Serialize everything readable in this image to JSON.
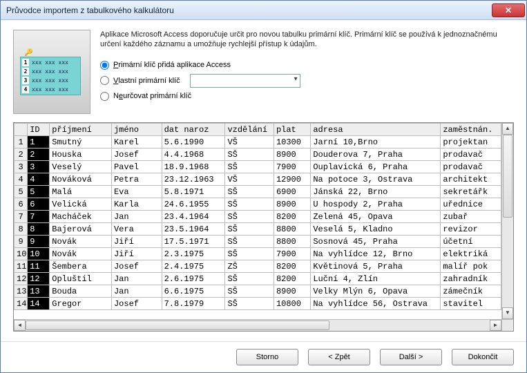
{
  "title": "Průvodce importem z tabulkového kalkulátoru",
  "description": "Aplikace Microsoft Access doporučuje určit pro novou tabulku primární klíč. Primární klíč se používá k jednoznačnému určení každého záznamu a umožňuje rychlejší přístup k údajům.",
  "radios": {
    "r1": "Primární klíč přidá aplikace Access",
    "r2": "Vlastní primární klíč",
    "r3": "Neurčovat primární klíč"
  },
  "headers": {
    "id": "ID",
    "prijmeni": "příjmení",
    "jmeno": "jméno",
    "datnaroz": "dat naroz",
    "vzdelani": "vzdělání",
    "plat": "plat",
    "adresa": "adresa",
    "zam": "zaměstnán."
  },
  "rows": [
    {
      "n": "1",
      "id": "1",
      "pr": "Smutný",
      "jm": "Karel",
      "dn": "5.6.1990",
      "vz": "VŠ",
      "pl": "10300",
      "ad": "Jarní 10,Brno",
      "za": "projektan"
    },
    {
      "n": "2",
      "id": "2",
      "pr": "Houska",
      "jm": "Josef",
      "dn": "4.4.1968",
      "vz": "SŠ",
      "pl": "8900",
      "ad": "Douderova 7, Praha",
      "za": "prodavač"
    },
    {
      "n": "3",
      "id": "3",
      "pr": "Veselý",
      "jm": "Pavel",
      "dn": "18.9.1968",
      "vz": "SŠ",
      "pl": "7900",
      "ad": "Ouplavická 6, Praha",
      "za": "prodavač"
    },
    {
      "n": "4",
      "id": "4",
      "pr": "Nováková",
      "jm": "Petra",
      "dn": "23.12.1963",
      "vz": "VŠ",
      "pl": "12900",
      "ad": "Na potoce 3, Ostrava",
      "za": "architekt"
    },
    {
      "n": "5",
      "id": "5",
      "pr": "Malá",
      "jm": "Eva",
      "dn": "5.8.1971",
      "vz": "SŠ",
      "pl": "6900",
      "ad": "Jánská 22, Brno",
      "za": "sekretářk"
    },
    {
      "n": "6",
      "id": "6",
      "pr": "Velická",
      "jm": "Karla",
      "dn": "24.6.1955",
      "vz": "SŠ",
      "pl": "8900",
      "ad": "U hospody 2, Praha",
      "za": "uřednice"
    },
    {
      "n": "7",
      "id": "7",
      "pr": "Macháček",
      "jm": "Jan",
      "dn": "23.4.1964",
      "vz": "SŠ",
      "pl": "8200",
      "ad": "Zelená 45, Opava",
      "za": "zubař"
    },
    {
      "n": "8",
      "id": "8",
      "pr": "Bajerová",
      "jm": "Vera",
      "dn": "23.5.1964",
      "vz": "SŠ",
      "pl": "8800",
      "ad": "Veselá 5, Kladno",
      "za": "revizor"
    },
    {
      "n": "9",
      "id": "9",
      "pr": "Novák",
      "jm": "Jiří",
      "dn": "17.5.1971",
      "vz": "SŠ",
      "pl": "8800",
      "ad": "Sosnová 45, Praha",
      "za": "účetní"
    },
    {
      "n": "10",
      "id": "10",
      "pr": "Novák",
      "jm": "Jiří",
      "dn": "2.3.1975",
      "vz": "SŠ",
      "pl": "7900",
      "ad": "Na vyhlídce 12, Brno",
      "za": "elektriká"
    },
    {
      "n": "11",
      "id": "11",
      "pr": "Šembera",
      "jm": "Josef",
      "dn": "2.4.1975",
      "vz": "ZŠ",
      "pl": "8200",
      "ad": "Květinová 5, Praha",
      "za": "malíř pok"
    },
    {
      "n": "12",
      "id": "12",
      "pr": "Opluštil",
      "jm": "Jan",
      "dn": "2.6.1975",
      "vz": "SŠ",
      "pl": "8200",
      "ad": "Luční 4, Zlín",
      "za": "zahradník"
    },
    {
      "n": "13",
      "id": "13",
      "pr": "Bouda",
      "jm": "Jan",
      "dn": "6.6.1975",
      "vz": "SŠ",
      "pl": "8900",
      "ad": "Velky Mlýn 6, Opava",
      "za": "zámečník"
    },
    {
      "n": "14",
      "id": "14",
      "pr": "Gregor",
      "jm": "Josef",
      "dn": "7.8.1979",
      "vz": "SŠ",
      "pl": "10800",
      "ad": "Na vyhlídce 56, Ostrava",
      "za": "stavitel"
    }
  ],
  "buttons": {
    "storno": "Storno",
    "zpet": "< Zpět",
    "dalsi": "Další >",
    "dokoncit": "Dokončit"
  }
}
